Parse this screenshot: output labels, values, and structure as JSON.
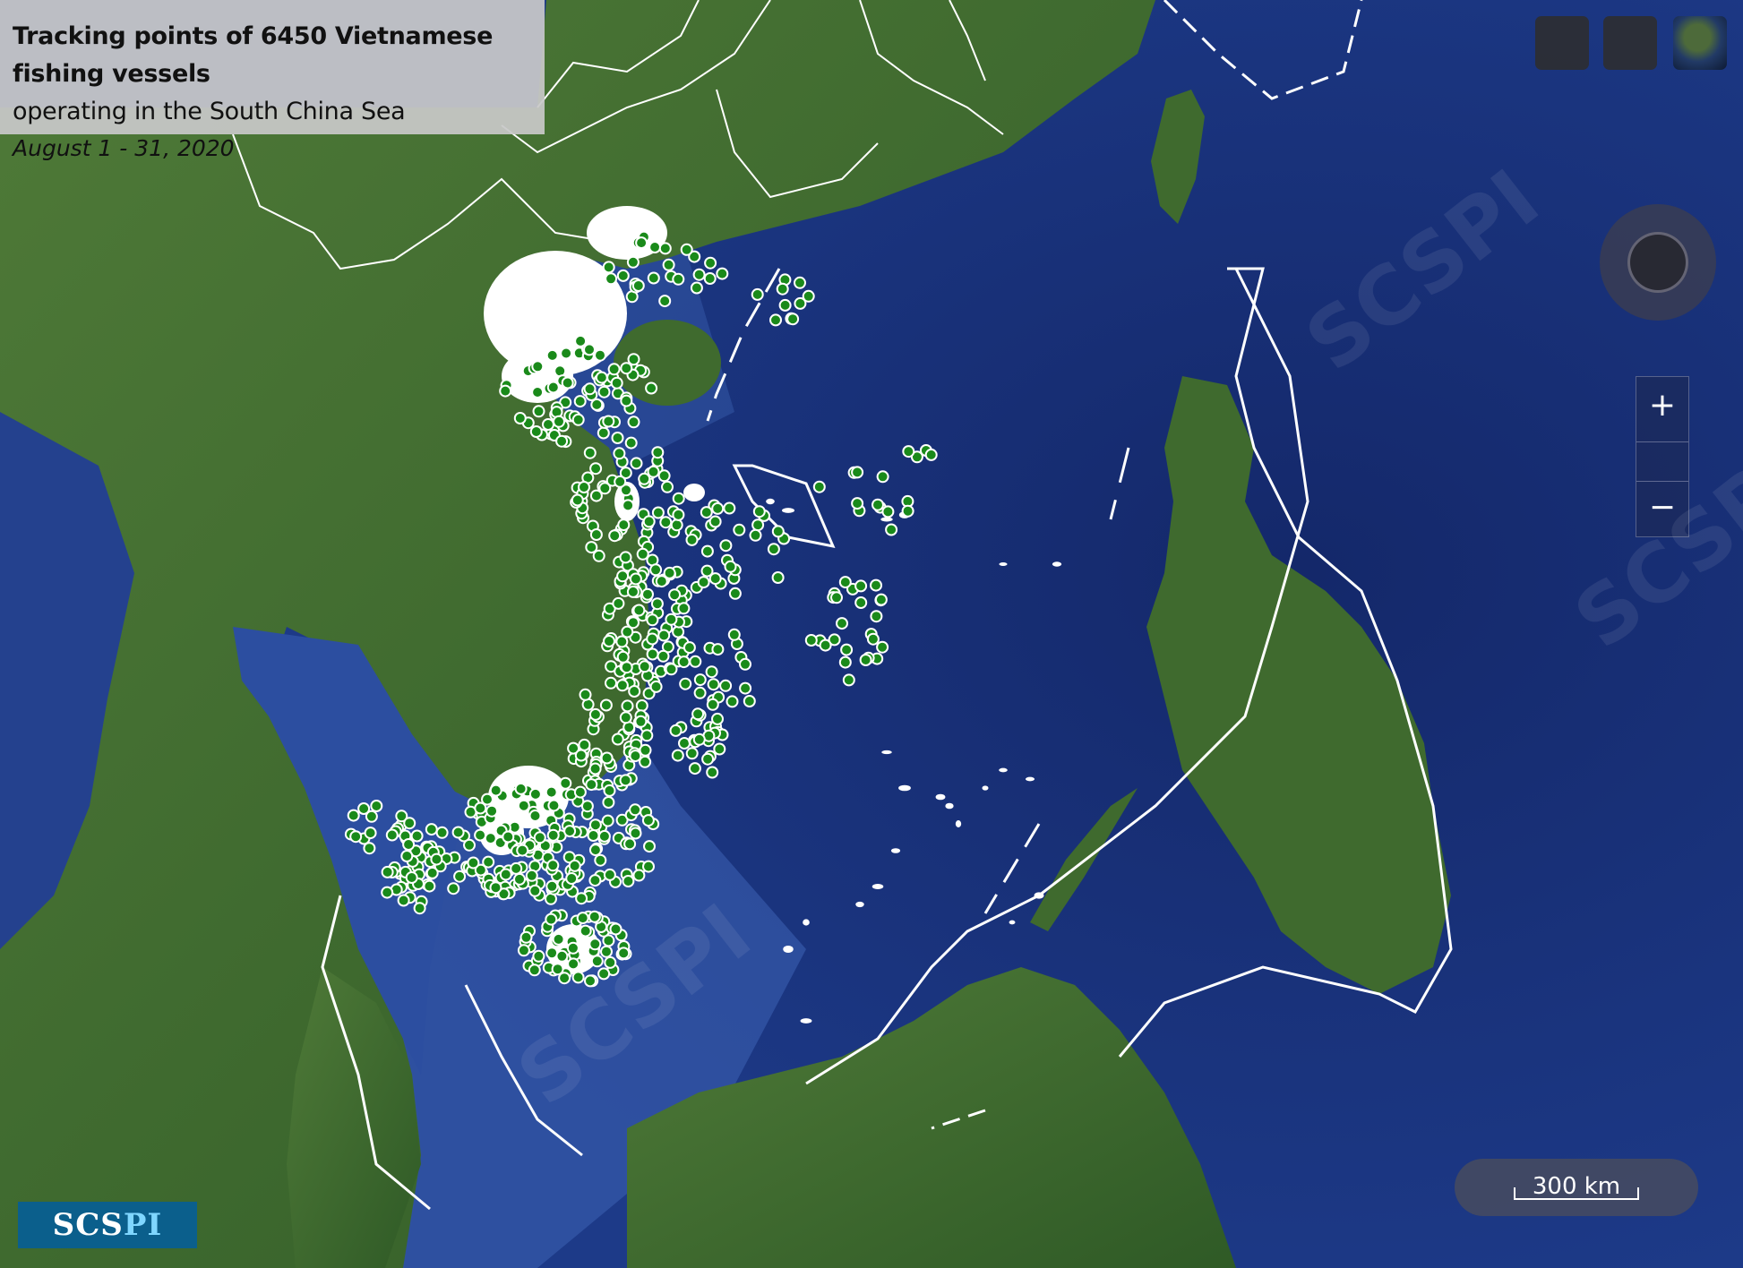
{
  "title": {
    "line1": "Tracking points of 6450 Vietnamese fishing vessels",
    "line2": "operating in the South China Sea",
    "date": "August 1 - 31, 2020"
  },
  "controls": {
    "zoom_in": "+",
    "zoom_out": "−"
  },
  "scale": {
    "label": "300 km"
  },
  "logo": {
    "main": "SCS",
    "accent": "PI"
  },
  "watermark": "SCSPI",
  "colors": {
    "ocean": "#1f3c8a",
    "land": "#3d6a2e",
    "vessel_point": "#1a8a1a",
    "vessel_point_stroke": "#ffffff",
    "boundary_line": "#ffffff",
    "logo_bg": "#0b5f8c"
  },
  "icons": [
    "compass-icon",
    "layer-thumbnail-icon",
    "zoom-in-icon",
    "zoom-out-icon"
  ]
}
